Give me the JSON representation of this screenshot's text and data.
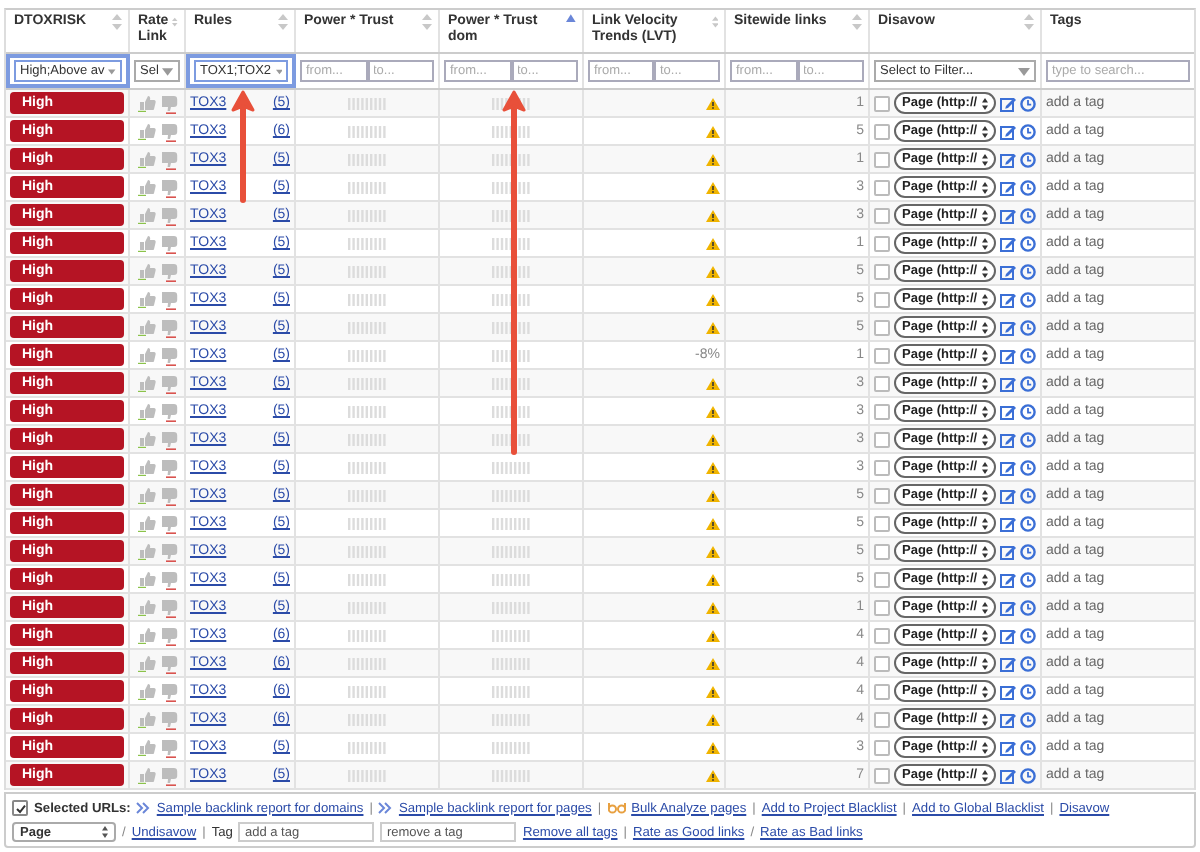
{
  "columns": [
    {
      "label": "DTOXRISK",
      "sorted": false,
      "filter": {
        "kind": "select",
        "value": "High;Above av",
        "active": true
      }
    },
    {
      "label": "Rate Link",
      "sorted": false,
      "filter": {
        "kind": "select",
        "value": "Sel",
        "active": false
      }
    },
    {
      "label": "Rules",
      "sorted": false,
      "filter": {
        "kind": "select",
        "value": "TOX1;TOX2",
        "active": true
      }
    },
    {
      "label": "Power * Trust",
      "sorted": false,
      "filter": {
        "kind": "range",
        "from_placeholder": "from...",
        "to_placeholder": "to..."
      }
    },
    {
      "label": "Power * Trust dom",
      "sorted": true,
      "filter": {
        "kind": "range",
        "from_placeholder": "from...",
        "to_placeholder": "to..."
      }
    },
    {
      "label": "Link Velocity Trends (LVT)",
      "sorted": false,
      "filter": {
        "kind": "range",
        "from_placeholder": "from...",
        "to_placeholder": "to..."
      }
    },
    {
      "label": "Sitewide links",
      "sorted": false,
      "filter": {
        "kind": "range",
        "from_placeholder": "from...",
        "to_placeholder": "to..."
      }
    },
    {
      "label": "Disavow",
      "sorted": false,
      "filter": {
        "kind": "select",
        "value": "Select to Filter...",
        "active": false
      }
    },
    {
      "label": "Tags",
      "filter": {
        "kind": "search",
        "placeholder": "type to search..."
      }
    }
  ],
  "rows": [
    {
      "risk": "High",
      "rule": "TOX3",
      "rule_count": "(5)",
      "lvt": {
        "kind": "warning"
      },
      "sitewide": "1",
      "checked": false,
      "disavow": "Page (http://",
      "tag": "add a tag"
    },
    {
      "risk": "High",
      "rule": "TOX3",
      "rule_count": "(6)",
      "lvt": {
        "kind": "warning"
      },
      "sitewide": "5",
      "checked": false,
      "disavow": "Page (http://",
      "tag": "add a tag"
    },
    {
      "risk": "High",
      "rule": "TOX3",
      "rule_count": "(5)",
      "lvt": {
        "kind": "warning"
      },
      "sitewide": "1",
      "checked": false,
      "disavow": "Page (http://",
      "tag": "add a tag"
    },
    {
      "risk": "High",
      "rule": "TOX3",
      "rule_count": "(5)",
      "lvt": {
        "kind": "warning"
      },
      "sitewide": "3",
      "checked": false,
      "disavow": "Page (http://",
      "tag": "add a tag"
    },
    {
      "risk": "High",
      "rule": "TOX3",
      "rule_count": "(5)",
      "lvt": {
        "kind": "warning"
      },
      "sitewide": "3",
      "checked": false,
      "disavow": "Page (http://",
      "tag": "add a tag"
    },
    {
      "risk": "High",
      "rule": "TOX3",
      "rule_count": "(5)",
      "lvt": {
        "kind": "warning"
      },
      "sitewide": "1",
      "checked": false,
      "disavow": "Page (http://",
      "tag": "add a tag"
    },
    {
      "risk": "High",
      "rule": "TOX3",
      "rule_count": "(5)",
      "lvt": {
        "kind": "warning"
      },
      "sitewide": "5",
      "checked": false,
      "disavow": "Page (http://",
      "tag": "add a tag"
    },
    {
      "risk": "High",
      "rule": "TOX3",
      "rule_count": "(5)",
      "lvt": {
        "kind": "warning"
      },
      "sitewide": "5",
      "checked": false,
      "disavow": "Page (http://",
      "tag": "add a tag"
    },
    {
      "risk": "High",
      "rule": "TOX3",
      "rule_count": "(5)",
      "lvt": {
        "kind": "warning"
      },
      "sitewide": "5",
      "checked": false,
      "disavow": "Page (http://",
      "tag": "add a tag"
    },
    {
      "risk": "High",
      "rule": "TOX3",
      "rule_count": "(5)",
      "lvt": {
        "kind": "text",
        "text": "-8%"
      },
      "sitewide": "1",
      "checked": false,
      "disavow": "Page (http://",
      "tag": "add a tag"
    },
    {
      "risk": "High",
      "rule": "TOX3",
      "rule_count": "(5)",
      "lvt": {
        "kind": "warning"
      },
      "sitewide": "3",
      "checked": false,
      "disavow": "Page (http://",
      "tag": "add a tag"
    },
    {
      "risk": "High",
      "rule": "TOX3",
      "rule_count": "(5)",
      "lvt": {
        "kind": "warning"
      },
      "sitewide": "3",
      "checked": false,
      "disavow": "Page (http://",
      "tag": "add a tag"
    },
    {
      "risk": "High",
      "rule": "TOX3",
      "rule_count": "(5)",
      "lvt": {
        "kind": "warning"
      },
      "sitewide": "3",
      "checked": false,
      "disavow": "Page (http://",
      "tag": "add a tag"
    },
    {
      "risk": "High",
      "rule": "TOX3",
      "rule_count": "(5)",
      "lvt": {
        "kind": "warning"
      },
      "sitewide": "3",
      "checked": false,
      "disavow": "Page (http://",
      "tag": "add a tag"
    },
    {
      "risk": "High",
      "rule": "TOX3",
      "rule_count": "(5)",
      "lvt": {
        "kind": "warning"
      },
      "sitewide": "5",
      "checked": false,
      "disavow": "Page (http://",
      "tag": "add a tag"
    },
    {
      "risk": "High",
      "rule": "TOX3",
      "rule_count": "(5)",
      "lvt": {
        "kind": "warning"
      },
      "sitewide": "5",
      "checked": false,
      "disavow": "Page (http://",
      "tag": "add a tag"
    },
    {
      "risk": "High",
      "rule": "TOX3",
      "rule_count": "(5)",
      "lvt": {
        "kind": "warning"
      },
      "sitewide": "5",
      "checked": false,
      "disavow": "Page (http://",
      "tag": "add a tag"
    },
    {
      "risk": "High",
      "rule": "TOX3",
      "rule_count": "(5)",
      "lvt": {
        "kind": "warning"
      },
      "sitewide": "5",
      "checked": false,
      "disavow": "Page (http://",
      "tag": "add a tag"
    },
    {
      "risk": "High",
      "rule": "TOX3",
      "rule_count": "(5)",
      "lvt": {
        "kind": "warning"
      },
      "sitewide": "1",
      "checked": false,
      "disavow": "Page (http://",
      "tag": "add a tag"
    },
    {
      "risk": "High",
      "rule": "TOX3",
      "rule_count": "(6)",
      "lvt": {
        "kind": "warning"
      },
      "sitewide": "4",
      "checked": false,
      "disavow": "Page (http://",
      "tag": "add a tag"
    },
    {
      "risk": "High",
      "rule": "TOX3",
      "rule_count": "(6)",
      "lvt": {
        "kind": "warning"
      },
      "sitewide": "4",
      "checked": false,
      "disavow": "Page (http://",
      "tag": "add a tag"
    },
    {
      "risk": "High",
      "rule": "TOX3",
      "rule_count": "(6)",
      "lvt": {
        "kind": "warning"
      },
      "sitewide": "4",
      "checked": false,
      "disavow": "Page (http://",
      "tag": "add a tag"
    },
    {
      "risk": "High",
      "rule": "TOX3",
      "rule_count": "(6)",
      "lvt": {
        "kind": "warning"
      },
      "sitewide": "4",
      "checked": false,
      "disavow": "Page (http://",
      "tag": "add a tag"
    },
    {
      "risk": "High",
      "rule": "TOX3",
      "rule_count": "(5)",
      "lvt": {
        "kind": "warning"
      },
      "sitewide": "3",
      "checked": false,
      "disavow": "Page (http://",
      "tag": "add a tag"
    },
    {
      "risk": "High",
      "rule": "TOX3",
      "rule_count": "(5)",
      "lvt": {
        "kind": "warning"
      },
      "sitewide": "7",
      "checked": false,
      "disavow": "Page (http://",
      "tag": "add a tag"
    }
  ],
  "footer": {
    "lines": [
      [
        {
          "kind": "checkbox",
          "checked": true
        },
        {
          "kind": "label",
          "text": "Selected URLs:"
        },
        {
          "kind": "report_link",
          "text": "Sample backlink report for domains"
        },
        {
          "kind": "sep",
          "text": "|"
        },
        {
          "kind": "report_link",
          "text": "Sample backlink report for pages"
        },
        {
          "kind": "sep",
          "text": "|"
        },
        {
          "kind": "analyze_link",
          "text": "Bulk Analyze pages"
        },
        {
          "kind": "sep",
          "text": "|"
        },
        {
          "kind": "link",
          "text": "Add to Project Blacklist"
        },
        {
          "kind": "sep",
          "text": "|"
        },
        {
          "kind": "link",
          "text": "Add to Global Blacklist"
        },
        {
          "kind": "sep",
          "text": "|"
        },
        {
          "kind": "link",
          "text": "Disavow"
        }
      ],
      [
        {
          "kind": "select",
          "text": "Page"
        },
        {
          "kind": "sep",
          "text": "/"
        },
        {
          "kind": "link",
          "text": "Undisavow"
        },
        {
          "kind": "sep",
          "text": "|"
        },
        {
          "kind": "plain",
          "text": "Tag"
        },
        {
          "kind": "input",
          "placeholder": "add a tag"
        },
        {
          "kind": "input",
          "placeholder": "remove a tag"
        },
        {
          "kind": "link",
          "text": "Remove all tags"
        },
        {
          "kind": "sep",
          "text": "|"
        },
        {
          "kind": "link",
          "text": "Rate as Good links"
        },
        {
          "kind": "sep",
          "text": "/"
        },
        {
          "kind": "link",
          "text": "Rate as Bad links"
        }
      ]
    ]
  }
}
